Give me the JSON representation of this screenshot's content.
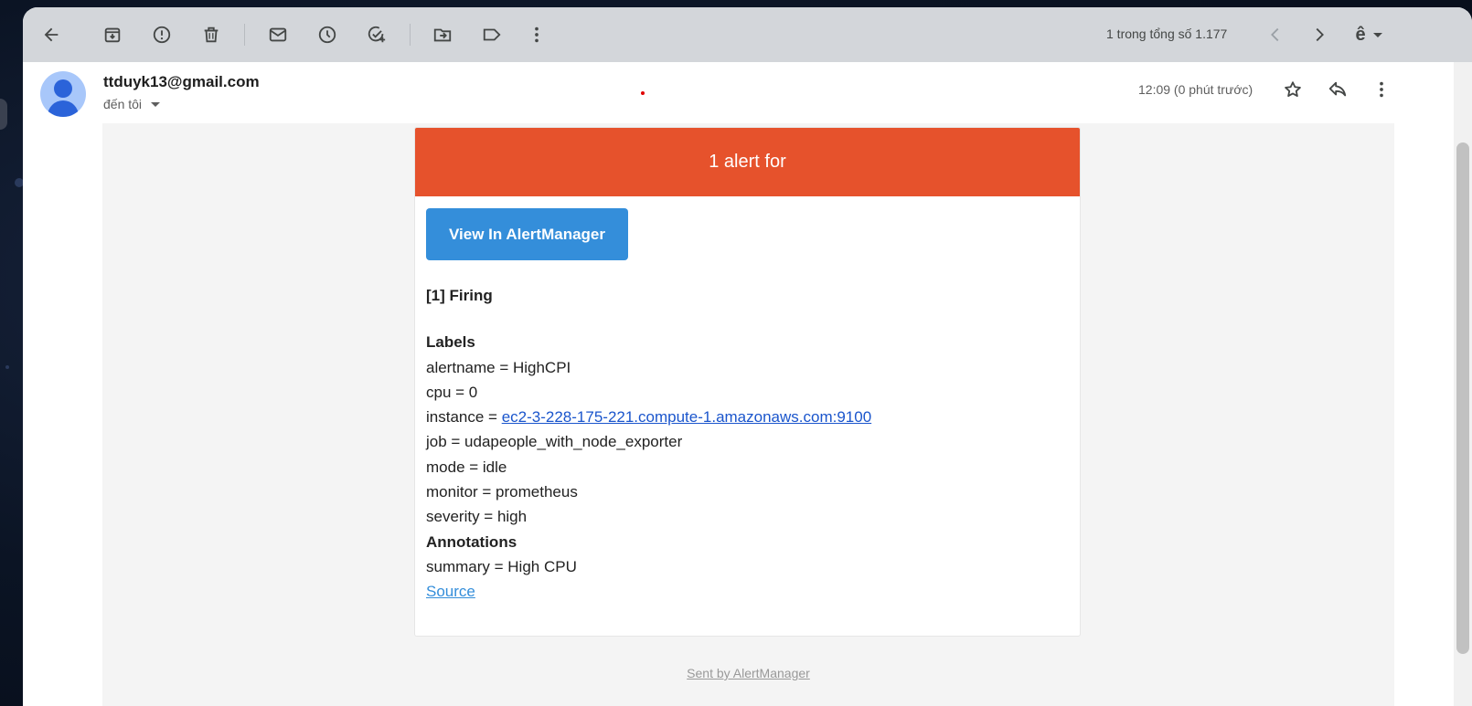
{
  "toolbar": {
    "icons": [
      "back-arrow-icon",
      "archive-icon",
      "report-spam-icon",
      "delete-icon",
      "mark-unread-icon",
      "snooze-icon",
      "add-task-icon",
      "move-to-icon",
      "label-icon",
      "more-vert-icon"
    ],
    "page_count": "1 trong tổng số 1.177",
    "language_icon": "ê"
  },
  "message": {
    "sender_email": "ttduyk13@gmail.com",
    "recipient": "đến tôi",
    "timestamp": "12:09 (0 phút trước)"
  },
  "alert": {
    "header_title": "1 alert for",
    "header_color": "#e6522c",
    "view_button_label": "View In AlertManager",
    "view_button_color": "#348eda",
    "firing_title": "[1] Firing",
    "labels_title": "Labels",
    "labels": {
      "alertname": "alertname = HighCPI",
      "cpu": "cpu = 0",
      "instance_prefix": "instance = ",
      "instance_link": "ec2-3-228-175-221.compute-1.amazonaws.com:9100",
      "job": "job = udapeople_with_node_exporter",
      "mode": "mode = idle",
      "monitor": "monitor = prometheus",
      "severity": "severity = high"
    },
    "annotations_title": "Annotations",
    "annotations": {
      "summary": "summary = High CPU"
    },
    "source_link": "Source",
    "footer": "Sent by AlertManager"
  }
}
